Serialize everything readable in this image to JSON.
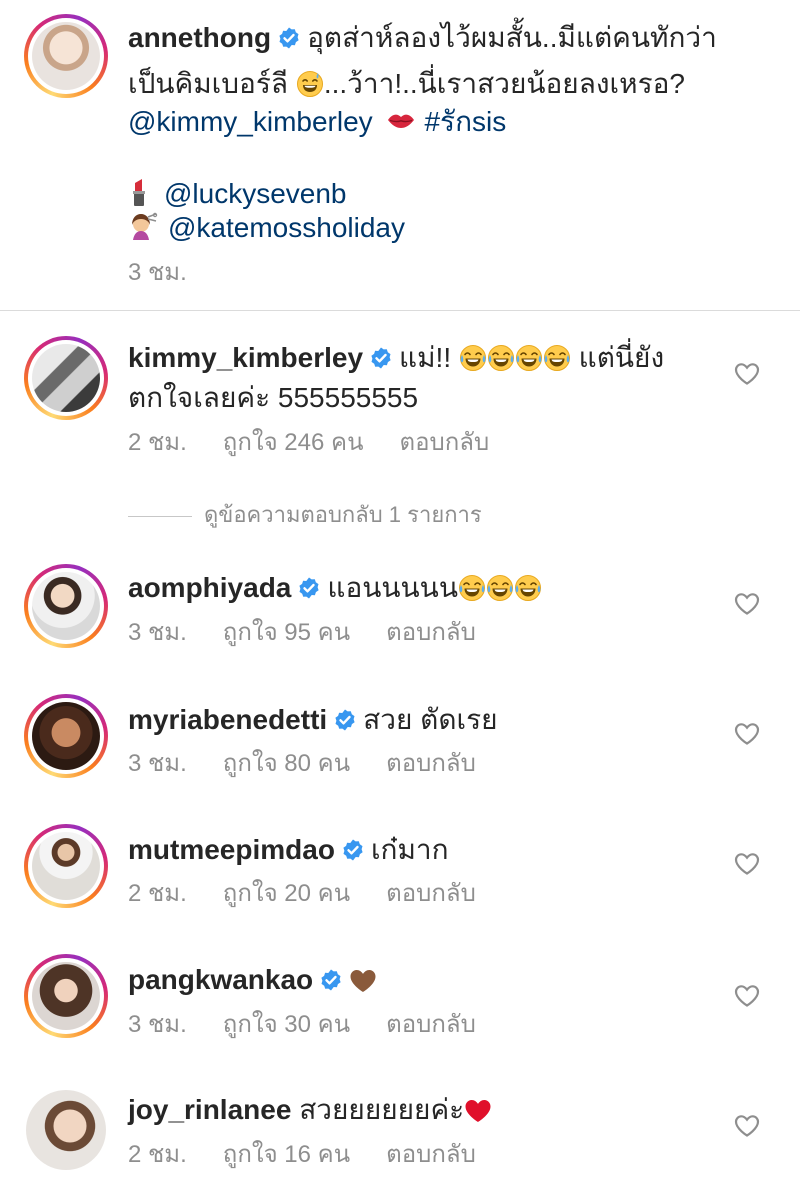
{
  "caption": {
    "username": "annethong",
    "text_line1": "อุตส่าห์ลองไว้ผมสั้น..มีแต่คนทักว่า",
    "text_line2a": "เป็นคิมเบอร์ลี",
    "text_line2b": "...ว้าา!..นี่เราสวยน้อยลงเหรอ?",
    "mention1": "@kimmy_kimberley",
    "hashtag": "#รักsis",
    "mention2": "@luckysevenb",
    "mention3": "@katemossholiday",
    "time": "3 ชม."
  },
  "view_replies": "ดูข้อความตอบกลับ 1 รายการ",
  "comments": [
    {
      "username": "kimmy_kimberley",
      "text_a": "แม่!!",
      "text_b": "แต่นี่ยัง",
      "text_line2": "ตกใจเลยค่ะ 555555555",
      "time": "2 ชม.",
      "likes": "ถูกใจ 246 คน",
      "reply": "ตอบกลับ"
    },
    {
      "username": "aomphiyada",
      "text_a": "แอนนนนน",
      "time": "3 ชม.",
      "likes": "ถูกใจ 95 คน",
      "reply": "ตอบกลับ"
    },
    {
      "username": "myriabenedetti",
      "text_a": "สวย ตัดเรย",
      "time": "3 ชม.",
      "likes": "ถูกใจ 80 คน",
      "reply": "ตอบกลับ"
    },
    {
      "username": "mutmeepimdao",
      "text_a": "เก๋มาก",
      "time": "2 ชม.",
      "likes": "ถูกใจ 20 คน",
      "reply": "ตอบกลับ"
    },
    {
      "username": "pangkwankao",
      "text_a": "",
      "time": "3 ชม.",
      "likes": "ถูกใจ 30 คน",
      "reply": "ตอบกลับ"
    },
    {
      "username": "joy_rinlanee",
      "text_a": "สวยยยยยยค่ะ",
      "time": "2 ชม.",
      "likes": "ถูกใจ 16 คน",
      "reply": "ตอบกลับ"
    }
  ],
  "icons": {
    "verified": "verified-badge-icon",
    "like": "heart-outline-icon",
    "kiss": "kiss-mark-icon",
    "lipstick": "lipstick-icon",
    "hairdresser": "woman-getting-haircut-icon",
    "laugh": "grinning-sweat-icon",
    "tears": "face-with-tears-of-joy-icon",
    "brown_heart": "brown-heart-icon",
    "red_heart": "red-heart-icon"
  },
  "colors": {
    "verified_blue": "#3897f0",
    "link": "#00376b",
    "meta_gray": "#8e8e8e"
  }
}
